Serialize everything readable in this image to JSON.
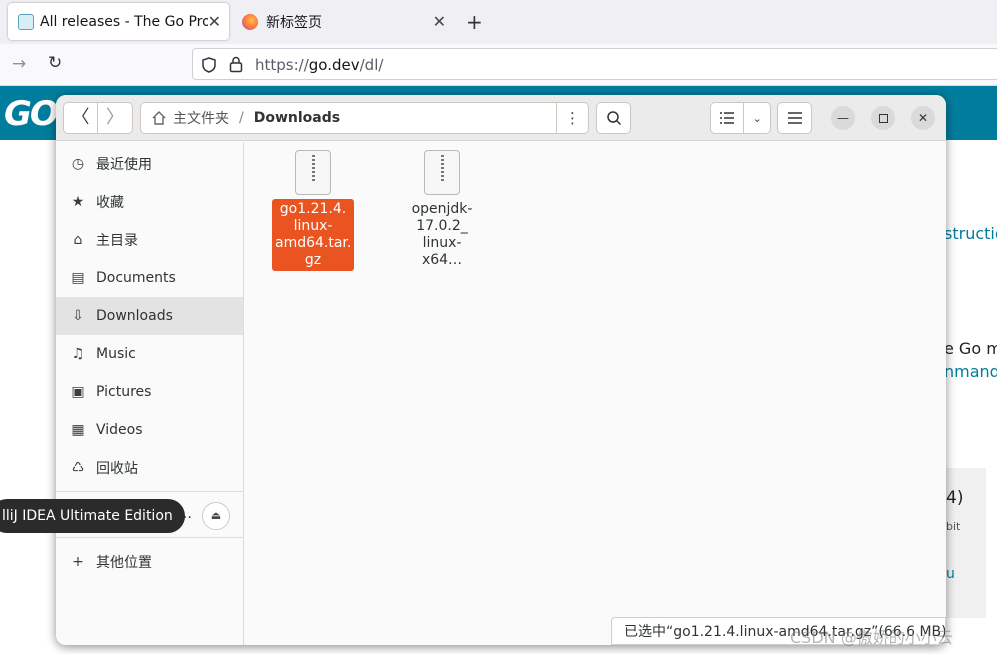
{
  "browser": {
    "tabs": [
      {
        "title": "All releases - The Go Prog",
        "icon": "go-gopher-icon",
        "active": true
      },
      {
        "title": "新标签页",
        "icon": "firefox-icon",
        "active": false
      }
    ],
    "new_tab_symbol": "+",
    "url_prefix": "https://",
    "url_domain": "go.dev",
    "url_path": "/dl/"
  },
  "page_behind": {
    "brand_text": "GO",
    "fragments": [
      "structio",
      "e Go mo",
      "nmand",
      "4)",
      "bit",
      "u"
    ]
  },
  "file_manager": {
    "path": [
      "主文件夹",
      "Downloads"
    ],
    "path_separator": "/",
    "sidebar": [
      {
        "label": "最近使用",
        "icon": "clock-icon"
      },
      {
        "label": "收藏",
        "icon": "star-icon"
      },
      {
        "label": "主目录",
        "icon": "home-icon"
      },
      {
        "label": "Documents",
        "icon": "document-icon"
      },
      {
        "label": "Downloads",
        "icon": "download-icon",
        "selected": true
      },
      {
        "label": "Music",
        "icon": "music-icon"
      },
      {
        "label": "Pictures",
        "icon": "picture-icon"
      },
      {
        "label": "Videos",
        "icon": "video-icon"
      },
      {
        "label": "回收站",
        "icon": "trash-icon"
      }
    ],
    "mounted_truncated": "…",
    "other_locations": "其他位置",
    "files": [
      {
        "name": "go1.21.4.linux-amd64.tar.gz",
        "lines": [
          "go1.21.4.",
          "linux-",
          "amd64.tar.",
          "gz"
        ],
        "selected": true
      },
      {
        "name": "openjdk-17.0.2_linux-x64…",
        "lines": [
          "openjdk-",
          "17.0.2_",
          "linux-x64…"
        ],
        "selected": false
      }
    ],
    "status": "已选中“go1.21.4.linux-amd64.tar.gz”(66.6 MB)",
    "tooltip": "lliJ IDEA Ultimate Edition",
    "accent_color": "#e95420"
  },
  "watermark": "CSDN @傲娇的小小云"
}
